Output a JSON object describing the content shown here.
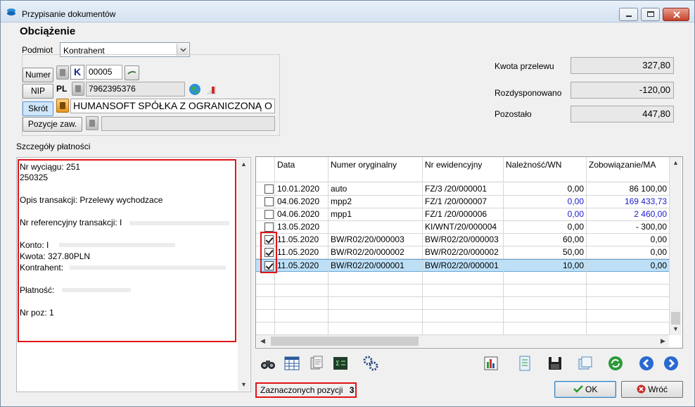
{
  "window": {
    "title": "Przypisanie dokumentów"
  },
  "heading": "Obciążenie",
  "subject": {
    "label": "Podmiot",
    "value": "Kontrahent",
    "buttons": {
      "numer": "Numer",
      "nip": "NIP",
      "skrot": "Skrót",
      "pozycje": "Pozycje zaw."
    },
    "k_label": "K",
    "number_value": "00005",
    "nip_prefix": "PL",
    "nip_value": "7962395376",
    "name_value": "HUMANSOFT SPÓŁKA Z OGRANICZONĄ O",
    "pozycje_value": ""
  },
  "amounts": {
    "kwota_label": "Kwota przelewu",
    "kwota_value": "327,80",
    "rozd_label": "Rozdysponowano",
    "rozd_value": "-120,00",
    "poz_label": "Pozostało",
    "poz_value": "447,80"
  },
  "details": {
    "label": "Szczegóły płatności",
    "lines": [
      "Nr wyciągu: 251",
      "250325",
      "Opis transakcji: Przelewy wychodzace",
      "Nr referencyjny transakcji: I",
      "Konto: I",
      "Kwota: 327.80PLN",
      "Kontrahent:",
      "Płatność:",
      "Nr poz: 1"
    ]
  },
  "grid": {
    "headers": [
      "Data",
      "Numer oryginalny",
      "Nr ewidencyjny",
      "Należność/WN",
      "Zobowiązanie/MA"
    ],
    "rows": [
      {
        "checked": false,
        "date": "10.01.2020",
        "orig": "auto",
        "ewid": "FZ/3  /20/000001",
        "wn": "0,00",
        "ma": "86 100,00",
        "blue": false
      },
      {
        "checked": false,
        "date": "04.06.2020",
        "orig": "mpp2",
        "ewid": "FZ/1  /20/000007",
        "wn": "0,00",
        "ma": "169 433,73",
        "blue": true
      },
      {
        "checked": false,
        "date": "04.06.2020",
        "orig": "mpp1",
        "ewid": "FZ/1  /20/000006",
        "wn": "0,00",
        "ma": "2 460,00",
        "blue": true
      },
      {
        "checked": false,
        "date": "13.05.2020",
        "orig": "",
        "ewid": "KI/WNT/20/000004",
        "wn": "0,00",
        "ma": "- 300,00",
        "blue": false
      },
      {
        "checked": true,
        "date": "11.05.2020",
        "orig": "BW/R02/20/000003",
        "ewid": "BW/R02/20/000003",
        "wn": "60,00",
        "ma": "0,00",
        "blue": false
      },
      {
        "checked": true,
        "date": "11.05.2020",
        "orig": "BW/R02/20/000002",
        "ewid": "BW/R02/20/000002",
        "wn": "50,00",
        "ma": "0,00",
        "blue": false
      },
      {
        "checked": true,
        "date": "11.05.2020",
        "orig": "BW/R02/20/000001",
        "ewid": "BW/R02/20/000001",
        "wn": "10,00",
        "ma": "0,00",
        "blue": false,
        "selected": true
      }
    ]
  },
  "status": {
    "label": "Zaznaczonych pozycji",
    "count": "3"
  },
  "buttons": {
    "ok": "OK",
    "back": "Wróć"
  },
  "colors": {
    "highlight": "#e0141a",
    "blue_value": "#1a1ad0",
    "selection": "#bde0f7"
  }
}
